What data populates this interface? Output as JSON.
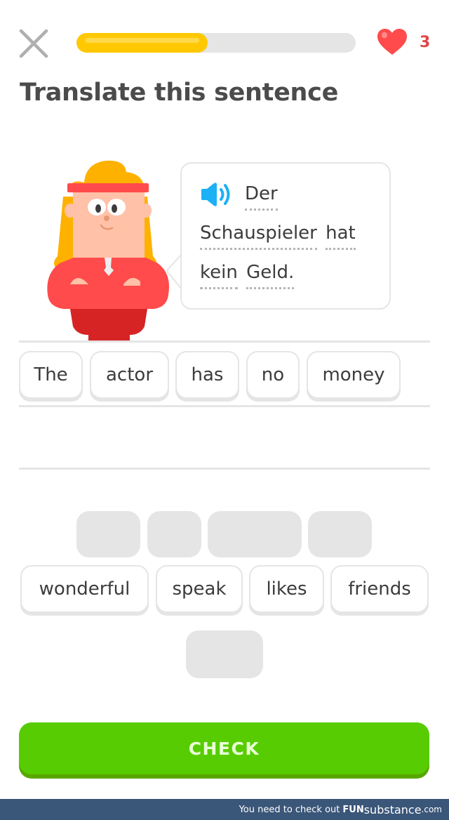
{
  "header": {
    "close_label": "Close",
    "progress_fraction": 0.47,
    "hearts_count": "3",
    "colors": {
      "progress": "#ffc800",
      "track": "#e5e5e5",
      "heart": "#ff4b4b"
    }
  },
  "title": "Translate this sentence",
  "prompt": {
    "speaker_icon": "speaker-icon",
    "lines": [
      [
        "Der"
      ],
      [
        "Schauspieler",
        "hat"
      ],
      [
        "kein",
        "Geld."
      ]
    ]
  },
  "answer_tiles": [
    "The",
    "actor",
    "has",
    "no",
    "money"
  ],
  "word_bank": {
    "used_slot_count_row1": 4,
    "available": [
      "wonderful",
      "speak",
      "likes",
      "friends"
    ],
    "used_slot_count_row3": 1
  },
  "check_button": {
    "label": "CHECK",
    "color": "#58cc02"
  },
  "watermark": {
    "prefix": "You need to check out ",
    "brand_bold": "FUN",
    "brand": "substance",
    "suffix": ".com"
  }
}
